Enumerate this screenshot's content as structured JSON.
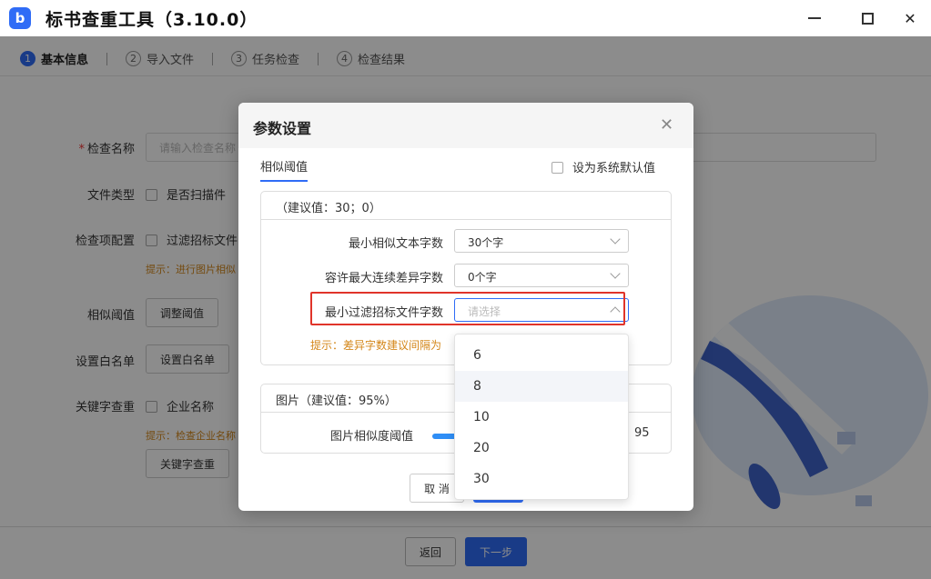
{
  "app": {
    "title": "标书查重工具（3.10.0）",
    "logo_letter": "b",
    "brand_color": "#2f6cf6"
  },
  "steps": [
    {
      "num": "1",
      "label": "基本信息",
      "active": true
    },
    {
      "num": "2",
      "label": "导入文件",
      "active": false
    },
    {
      "num": "3",
      "label": "任务检查",
      "active": false
    },
    {
      "num": "4",
      "label": "检查结果",
      "active": false
    }
  ],
  "form": {
    "check_name_label": "检查名称",
    "check_name_placeholder": "请输入检查名称",
    "file_type_label": "文件类型",
    "file_type_option": "是否扫描件",
    "check_item_label": "检查项配置",
    "check_item_option": "过滤招标文件",
    "check_item_hint": "提示：进行图片相似",
    "similarity_label": "相似阈值",
    "similarity_button": "调整阈值",
    "whitelist_label": "设置白名单",
    "whitelist_button": "设置白名单",
    "keyword_label": "关键字查重",
    "keyword_option": "企业名称",
    "keyword_hint": "提示：检查企业名称",
    "keyword_button": "关键字查重"
  },
  "footer": {
    "back_label": "返回",
    "next_label": "下一步"
  },
  "modal": {
    "title": "参数设置",
    "tab_label": "相似阈值",
    "default_checkbox_label": "设为系统默认值",
    "text_group": {
      "header": "（建议值：30；0）",
      "fields": [
        {
          "label": "最小相似文本字数",
          "value": "30个字"
        },
        {
          "label": "容许最大连续差异字数",
          "value": "0个字"
        },
        {
          "label": "最小过滤招标文件字数",
          "placeholder": "请选择"
        }
      ],
      "hint": "提示：差异字数建议间隔为"
    },
    "image_group": {
      "header": "图片（建议值：95%）",
      "slider_label": "图片相似度阈值",
      "slider_value": "95",
      "slider_percent": 95
    },
    "cancel_label": "取 消"
  },
  "dropdown": {
    "options": [
      "6",
      "8",
      "10",
      "20",
      "30"
    ],
    "hovered_index": 1
  }
}
